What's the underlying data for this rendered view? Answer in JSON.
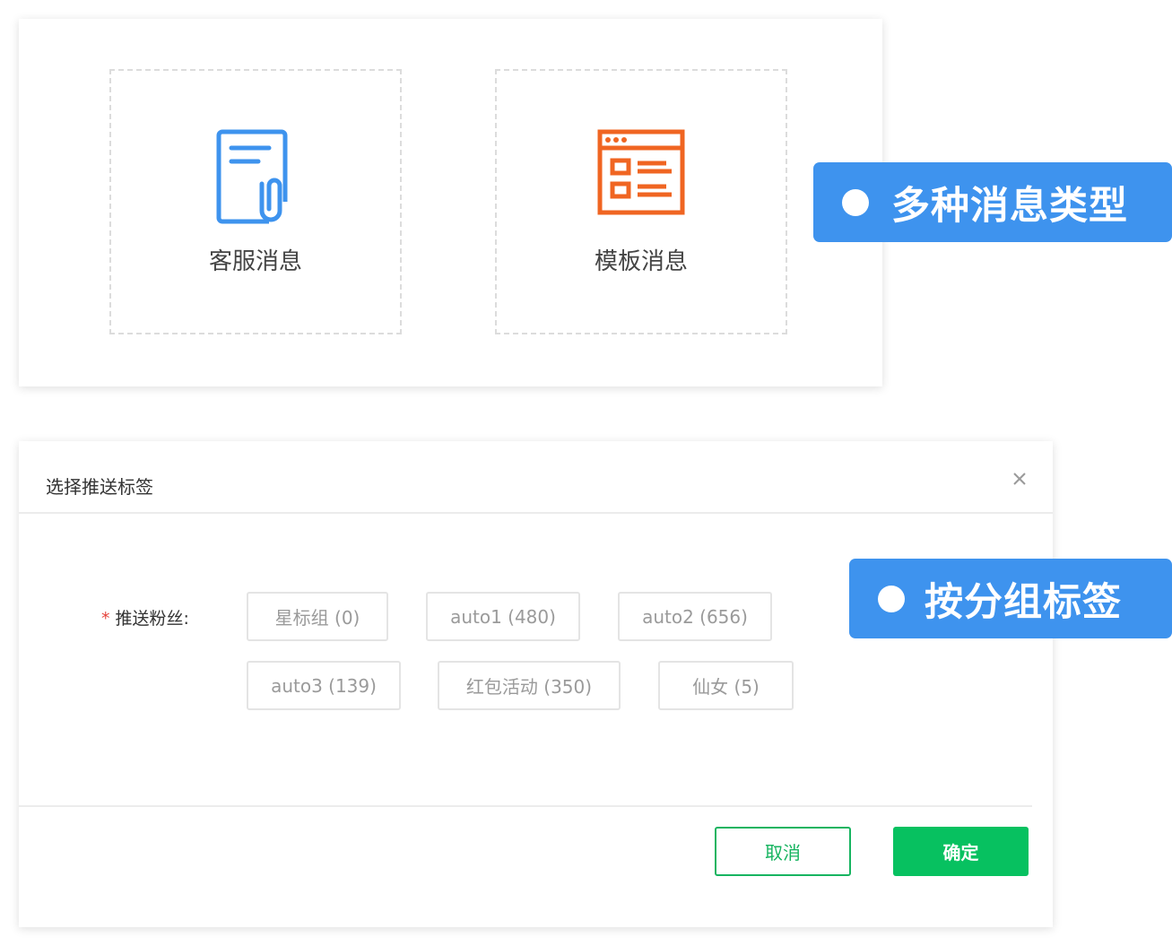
{
  "message_types": [
    {
      "label": "客服消息",
      "icon": "document-clip-icon",
      "color": "#3e93ee"
    },
    {
      "label": "模板消息",
      "icon": "template-window-icon",
      "color": "#f06522"
    }
  ],
  "callouts": {
    "types": "多种消息类型",
    "tags": "按分组标签"
  },
  "dialog": {
    "title": "选择推送标签",
    "close_icon": "close-icon",
    "field_label": "推送粉丝:",
    "required_mark": "*",
    "tags": [
      "星标组 (0)",
      "auto1 (480)",
      "auto2 (656)",
      "auto3 (139)",
      "红包活动 (350)",
      "仙女 (5)"
    ],
    "cancel_label": "取消",
    "confirm_label": "确定"
  },
  "colors": {
    "accent_blue": "#3e93ee",
    "accent_orange": "#f06522",
    "primary_green": "#07c160"
  }
}
